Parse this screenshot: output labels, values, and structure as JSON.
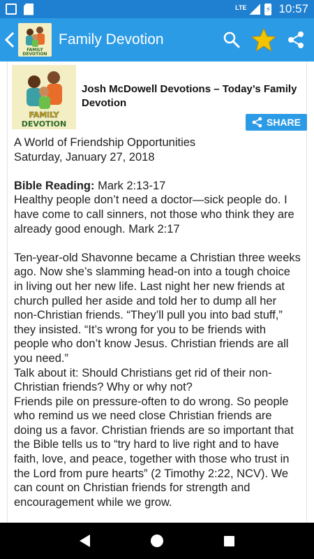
{
  "status_bar": {
    "network": "LTE",
    "time": "10:57"
  },
  "app_bar": {
    "title": "Family Devotion",
    "logo_text": "FAMILY DEVOTION"
  },
  "article": {
    "title": "Josh McDowell Devotions – Today’s Family Devotion",
    "share_label": "SHARE",
    "heading": "A World of Friendship Opportunities",
    "date": "Saturday, January 27, 2018",
    "bible_label": "Bible Reading:",
    "bible_ref": " Mark 2:13-17",
    "verse": "Healthy people don’t need a doctor—sick people do. I have come to call sinners, not those who think they are already good enough. Mark 2:17",
    "para1": "Ten-year-old Shavonne became a Christian three weeks ago. Now she’s slamming head-on into a tough choice in living out her new life. Last night her new friends at church pulled her aside and told her to dump all her non-Christian friends. “They’ll pull you into bad stuff,” they insisted. “It’s wrong for you to be friends with people who don’t know Jesus. Christian friends are all you need.”",
    "para2": "Talk about it: Should Christians get rid of their non-Christian friends? Why or why not?",
    "para3": "Friends pile on pressure-often to do wrong. So people who remind us we need close Christian friends are doing us a favor. Christian friends are so important that the Bible tells us to “try hard to live right and to have faith, love, and peace, together with those who trust in the Lord from pure hearts” (2 Timothy 2:22, NCV). We can count on Christian friends for strength and encouragement while we grow."
  },
  "colors": {
    "status_bar": "#1f7fd0",
    "app_bar": "#2c9be6",
    "star": "#f5c400",
    "logo_bg": "#f4eec4"
  },
  "icons": {
    "back": "chevron-left-icon",
    "search": "search-icon",
    "favorite": "star-icon",
    "share": "share-icon"
  }
}
